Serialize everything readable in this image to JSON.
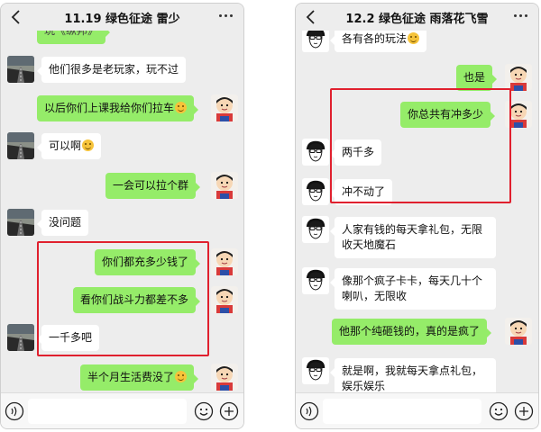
{
  "left": {
    "title": "11.19 绿色征途 雷少",
    "cutoff_text": "玩《纵邦》",
    "messages": [
      {
        "text": "他们很多是老玩家，玩不过"
      },
      {
        "text": "以后你们上课我给你们拉车"
      },
      {
        "text": "可以啊"
      },
      {
        "text": "一会可以拉个群"
      },
      {
        "text": "没问题"
      },
      {
        "text": "你们都充多少钱了"
      },
      {
        "text": "看你们战斗力都差不多"
      },
      {
        "text": "一千多吧"
      },
      {
        "text": "半个月生活费没了"
      }
    ]
  },
  "right": {
    "title": "12.2 绿色征途 雨落花飞雪",
    "messages": [
      {
        "text": "各有各的玩法"
      },
      {
        "text": "也是"
      },
      {
        "text": "你总共有冲多少"
      },
      {
        "text": "两千多"
      },
      {
        "text": "冲不动了"
      },
      {
        "text": "人家有钱的每天拿礼包，无限收天地魔石"
      },
      {
        "text": "像那个疯子卡卡，每天几十个喇叭，无限收"
      },
      {
        "text": "他那个纯砸钱的，真的是疯了"
      },
      {
        "text": "就是啊，我就每天拿点礼包，娱乐娱乐"
      }
    ]
  },
  "colors": {
    "chat_background": "#ededed",
    "incoming_bubble": "#ffffff",
    "outgoing_bubble": "#95ec69",
    "highlight_box": "#e0202e"
  },
  "icons": [
    "back-icon",
    "more-icon",
    "voice-icon",
    "emoji-icon",
    "plus-icon"
  ]
}
